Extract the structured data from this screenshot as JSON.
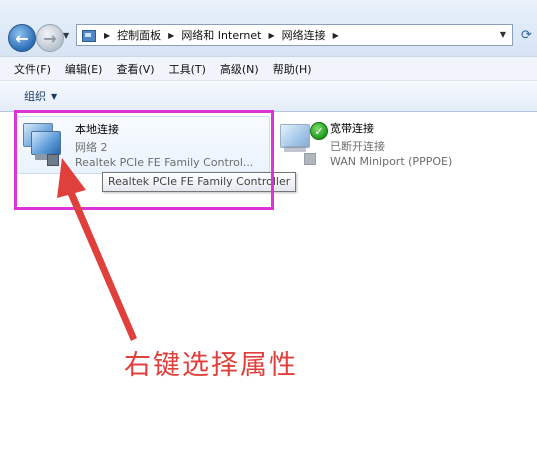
{
  "address": {
    "breadcrumbs": [
      "控制面板",
      "网络和 Internet",
      "网络连接"
    ]
  },
  "menu": [
    "文件(F)",
    "编辑(E)",
    "查看(V)",
    "工具(T)",
    "高级(N)",
    "帮助(H)"
  ],
  "toolbar": {
    "organize_label": "组织"
  },
  "connections": [
    {
      "name": "本地连接",
      "status": "网络  2",
      "device": "Realtek PCIe FE Family Control..."
    },
    {
      "name": "宽带连接",
      "status": "已断开连接",
      "device": "WAN Miniport (PPPOE)"
    }
  ],
  "tooltip": "Realtek PCIe FE Family Controller",
  "annotation": {
    "text": "右键选择属性",
    "color": "#e0403c",
    "highlight_color": "#dc34d7"
  },
  "icons": [
    "back-arrow-icon",
    "forward-arrow-icon",
    "control-panel-icon",
    "refresh-icon",
    "network-adapter-icon",
    "connected-check-icon"
  ]
}
